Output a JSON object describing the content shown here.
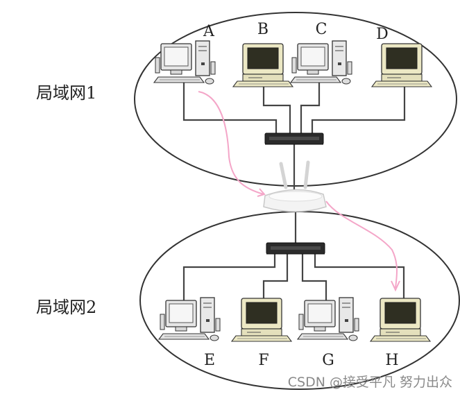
{
  "networks": [
    {
      "label": "局域网1",
      "computers": [
        {
          "label": "A",
          "kind": "tower"
        },
        {
          "label": "B",
          "kind": "mac"
        },
        {
          "label": "C",
          "kind": "tower"
        },
        {
          "label": "D",
          "kind": "mac"
        }
      ]
    },
    {
      "label": "局域网2",
      "computers": [
        {
          "label": "E",
          "kind": "tower"
        },
        {
          "label": "F",
          "kind": "mac"
        },
        {
          "label": "G",
          "kind": "tower"
        },
        {
          "label": "H",
          "kind": "mac"
        }
      ]
    }
  ],
  "devices": {
    "switch_1": "switch-icon",
    "switch_2": "switch-icon",
    "router": "wireless-router-icon"
  },
  "data_path": {
    "from": "A",
    "to": "H",
    "via": "router",
    "color": "#f4a6c8"
  },
  "watermark": "CSDN @接受平凡 努力出众"
}
